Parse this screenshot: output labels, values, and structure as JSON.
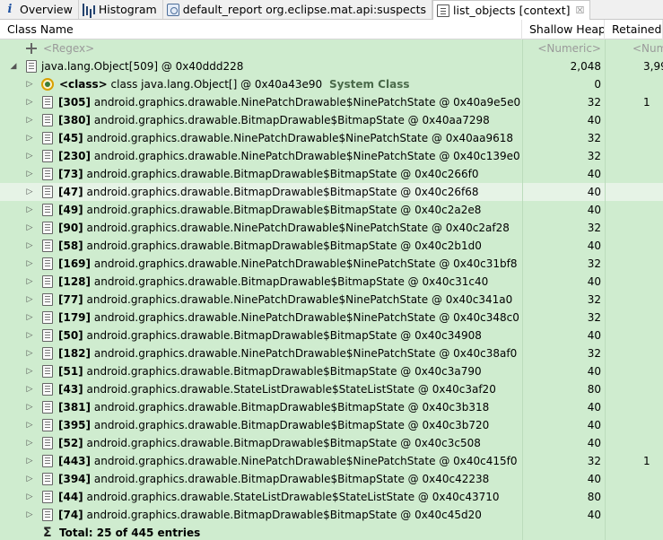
{
  "tabs": [
    {
      "label": "Overview",
      "icon": "info-icon",
      "active": false
    },
    {
      "label": "Histogram",
      "icon": "histogram-icon",
      "active": false
    },
    {
      "label": "default_report  org.eclipse.mat.api:suspects",
      "icon": "report-icon",
      "active": false
    },
    {
      "label": "list_objects [context]",
      "icon": "document-icon",
      "active": true,
      "close": "☒"
    }
  ],
  "columns": {
    "name": "Class Name",
    "shallow": "Shallow Heap",
    "retained": "Retained"
  },
  "filter": {
    "name": "<Regex>",
    "shallow": "<Numeric>",
    "retained": "<Num"
  },
  "root": {
    "twisty": "◢",
    "label": "java.lang.Object[509] @ 0x40ddd228",
    "shallow": "2,048",
    "retained": "3,99"
  },
  "class_row": {
    "twisty": "▷",
    "tag": "<class>",
    "label": "class java.lang.Object[] @ 0x40a43e90",
    "suffix": "System Class",
    "shallow": "0",
    "retained": ""
  },
  "rows": [
    {
      "index": "[305]",
      "label": "android.graphics.drawable.NinePatchDrawable$NinePatchState @ 0x40a9e5e0",
      "shallow": "32",
      "retained": "1"
    },
    {
      "index": "[380]",
      "label": "android.graphics.drawable.BitmapDrawable$BitmapState @ 0x40aa7298",
      "shallow": "40",
      "retained": ""
    },
    {
      "index": "[45]",
      "label": "android.graphics.drawable.NinePatchDrawable$NinePatchState @ 0x40aa9618",
      "shallow": "32",
      "retained": ""
    },
    {
      "index": "[230]",
      "label": "android.graphics.drawable.NinePatchDrawable$NinePatchState @ 0x40c139e0",
      "shallow": "32",
      "retained": ""
    },
    {
      "index": "[73]",
      "label": "android.graphics.drawable.BitmapDrawable$BitmapState @ 0x40c266f0",
      "shallow": "40",
      "retained": ""
    },
    {
      "index": "[47]",
      "label": "android.graphics.drawable.BitmapDrawable$BitmapState @ 0x40c26f68",
      "shallow": "40",
      "retained": "",
      "selected": true
    },
    {
      "index": "[49]",
      "label": "android.graphics.drawable.BitmapDrawable$BitmapState @ 0x40c2a2e8",
      "shallow": "40",
      "retained": ""
    },
    {
      "index": "[90]",
      "label": "android.graphics.drawable.NinePatchDrawable$NinePatchState @ 0x40c2af28",
      "shallow": "32",
      "retained": ""
    },
    {
      "index": "[58]",
      "label": "android.graphics.drawable.BitmapDrawable$BitmapState @ 0x40c2b1d0",
      "shallow": "40",
      "retained": ""
    },
    {
      "index": "[169]",
      "label": "android.graphics.drawable.NinePatchDrawable$NinePatchState @ 0x40c31bf8",
      "shallow": "32",
      "retained": ""
    },
    {
      "index": "[128]",
      "label": "android.graphics.drawable.BitmapDrawable$BitmapState @ 0x40c31c40",
      "shallow": "40",
      "retained": ""
    },
    {
      "index": "[77]",
      "label": "android.graphics.drawable.NinePatchDrawable$NinePatchState @ 0x40c341a0",
      "shallow": "32",
      "retained": ""
    },
    {
      "index": "[179]",
      "label": "android.graphics.drawable.NinePatchDrawable$NinePatchState @ 0x40c348c0",
      "shallow": "32",
      "retained": ""
    },
    {
      "index": "[50]",
      "label": "android.graphics.drawable.BitmapDrawable$BitmapState @ 0x40c34908",
      "shallow": "40",
      "retained": ""
    },
    {
      "index": "[182]",
      "label": "android.graphics.drawable.NinePatchDrawable$NinePatchState @ 0x40c38af0",
      "shallow": "32",
      "retained": ""
    },
    {
      "index": "[51]",
      "label": "android.graphics.drawable.BitmapDrawable$BitmapState @ 0x40c3a790",
      "shallow": "40",
      "retained": ""
    },
    {
      "index": "[43]",
      "label": "android.graphics.drawable.StateListDrawable$StateListState @ 0x40c3af20",
      "shallow": "80",
      "retained": ""
    },
    {
      "index": "[381]",
      "label": "android.graphics.drawable.BitmapDrawable$BitmapState @ 0x40c3b318",
      "shallow": "40",
      "retained": ""
    },
    {
      "index": "[395]",
      "label": "android.graphics.drawable.BitmapDrawable$BitmapState @ 0x40c3b720",
      "shallow": "40",
      "retained": ""
    },
    {
      "index": "[52]",
      "label": "android.graphics.drawable.BitmapDrawable$BitmapState @ 0x40c3c508",
      "shallow": "40",
      "retained": ""
    },
    {
      "index": "[443]",
      "label": "android.graphics.drawable.NinePatchDrawable$NinePatchState @ 0x40c415f0",
      "shallow": "32",
      "retained": "1"
    },
    {
      "index": "[394]",
      "label": "android.graphics.drawable.BitmapDrawable$BitmapState @ 0x40c42238",
      "shallow": "40",
      "retained": ""
    },
    {
      "index": "[44]",
      "label": "android.graphics.drawable.StateListDrawable$StateListState @ 0x40c43710",
      "shallow": "80",
      "retained": ""
    },
    {
      "index": "[74]",
      "label": "android.graphics.drawable.BitmapDrawable$BitmapState @ 0x40c45d20",
      "shallow": "40",
      "retained": ""
    }
  ],
  "row_twisty": "▷",
  "total": {
    "icon": "sum-icon",
    "glyph": "Σ",
    "label": "Total: 25 of 445 entries"
  }
}
